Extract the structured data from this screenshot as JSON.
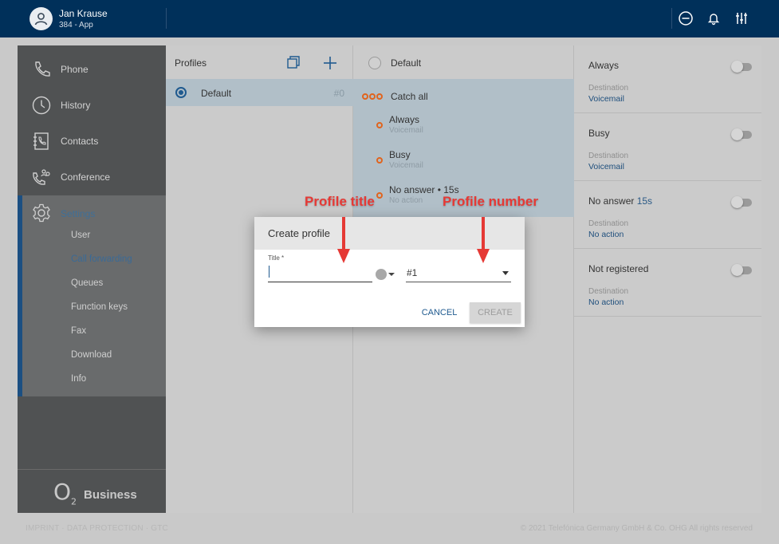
{
  "header": {
    "user_name": "Jan Krause",
    "user_line": "384 - App",
    "icons": [
      "user-avatar-icon",
      "do-not-disturb-icon",
      "bell-icon",
      "sliders-icon"
    ]
  },
  "sidebar": {
    "items": [
      {
        "label": "Phone",
        "icon": "phone-icon"
      },
      {
        "label": "History",
        "icon": "clock-icon"
      },
      {
        "label": "Contacts",
        "icon": "contacts-book-icon"
      },
      {
        "label": "Conference",
        "icon": "conference-phone-icon"
      }
    ],
    "settings": {
      "label": "Settings",
      "icon": "gear-icon",
      "sub_items": [
        "User",
        "Call forwarding",
        "Queues",
        "Function keys",
        "Fax",
        "Download",
        "Info"
      ],
      "active_sub": "Call forwarding"
    },
    "footer_logo": "O",
    "footer_logo_sub": "2",
    "footer_brand": "Business"
  },
  "profiles": {
    "title": "Profiles",
    "items": [
      {
        "name": "Default",
        "number": "#0",
        "selected": true
      }
    ]
  },
  "rules": {
    "profile_name": "Default",
    "catch_all": "Catch all",
    "items": [
      {
        "title": "Always",
        "sub": "Voicemail"
      },
      {
        "title": "Busy",
        "sub": "Voicemail"
      },
      {
        "title": "No answer • 15s",
        "sub": "No action"
      }
    ]
  },
  "details": {
    "cards": [
      {
        "title": "Always",
        "title_extra": "",
        "dest_label": "Destination",
        "dest_value": "Voicemail"
      },
      {
        "title": "Busy",
        "title_extra": "",
        "dest_label": "Destination",
        "dest_value": "Voicemail"
      },
      {
        "title": "No answer",
        "title_extra": "15s",
        "dest_label": "Destination",
        "dest_value": "No action"
      },
      {
        "title": "Not registered",
        "title_extra": "",
        "dest_label": "Destination",
        "dest_value": "No action"
      }
    ]
  },
  "dialog": {
    "title": "Create profile",
    "title_field_label": "Title *",
    "title_value": "",
    "number_value": "#1",
    "cancel_label": "CANCEL",
    "create_label": "CREATE"
  },
  "annotations": {
    "profile_title": "Profile title",
    "profile_number": "Profile number",
    "color": "#e53935"
  },
  "footer": {
    "links": "IMPRINT · DATA PROTECTION · GTC",
    "copyright": "© 2021 Telefónica Germany GmbH & Co. OHG All rights reserved"
  },
  "colors": {
    "header_bg": "#00305a",
    "accent": "#1f5a8f",
    "highlight_row": "#b1bfc8",
    "rule_dot": "#e0641e"
  }
}
